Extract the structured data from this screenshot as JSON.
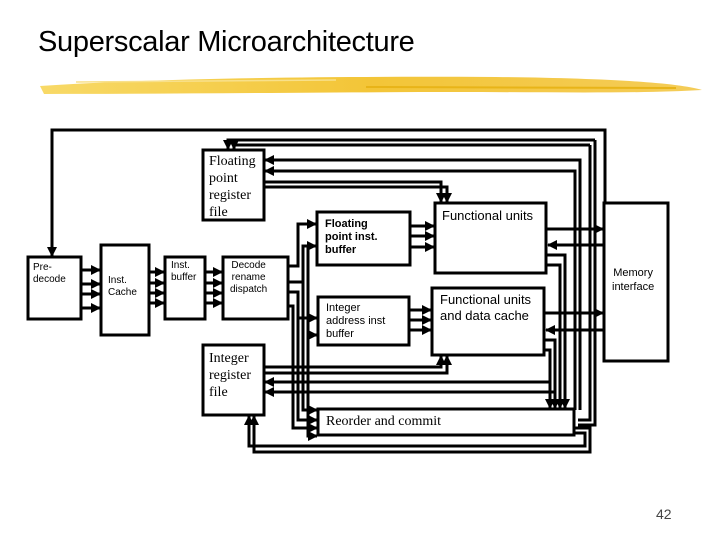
{
  "slide": {
    "title": "Superscalar Microarchitecture",
    "page_number": "42",
    "accent_color": "#f2c230"
  },
  "blocks": {
    "predecode": "Pre-\ndecode",
    "inst_cache": "Inst.\nCache",
    "inst_buffer": "Inst.\nbuffer",
    "decode": "Decode\nrename\ndispatch",
    "fp_regfile": "Floating\npoint\nregister\nfile",
    "fp_inst_buffer": "Floating\npoint inst.\nbuffer",
    "int_addr_buffer": "Integer\naddress inst\nbuffer",
    "functional_units": "Functional units",
    "fu_data_cache": "Functional units\nand data cache",
    "memory_interface": "Memory\ninterface",
    "int_regfile": "Integer\nregister\nfile",
    "reorder_commit": "Reorder and commit"
  }
}
